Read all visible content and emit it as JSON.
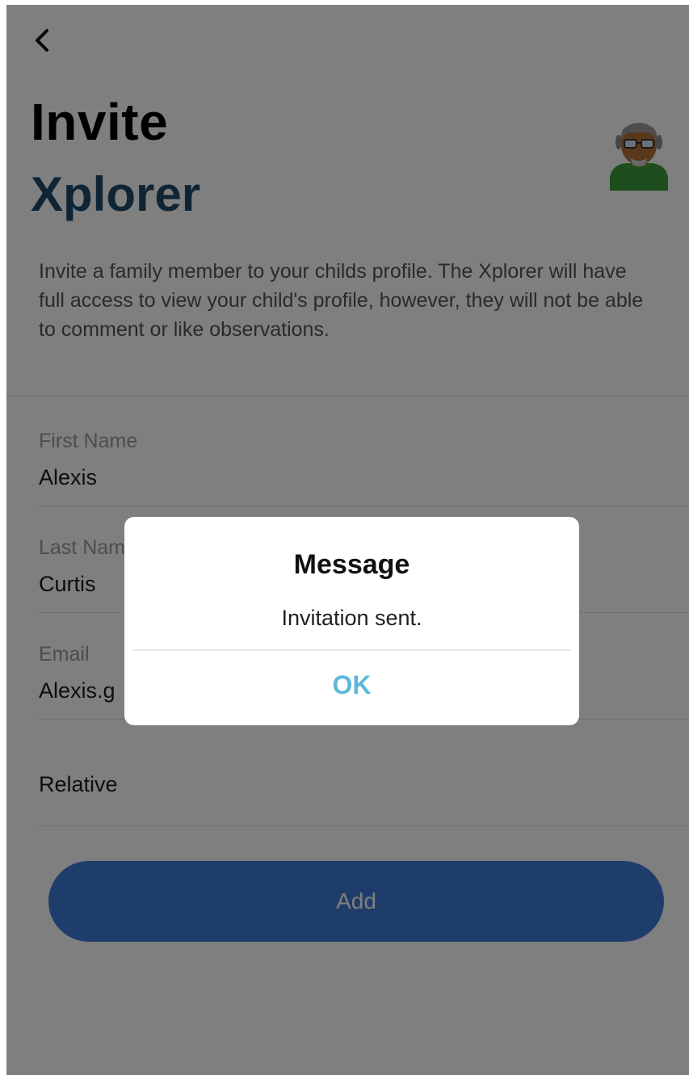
{
  "header": {
    "title": "Invite",
    "subtitle": "Xplorer",
    "avatar_icon": "elderly-man-avatar-icon"
  },
  "description": "Invite a family member to your childs profile. The Xplorer will have full access to view your child's profile, however, they will not be able to comment or like observations.",
  "form": {
    "first_name": {
      "label": "First Name",
      "value": "Alexis"
    },
    "last_name": {
      "label": "Last Name",
      "value": "Curtis"
    },
    "email": {
      "label": "Email",
      "value": "Alexis.g"
    },
    "relationship": {
      "value": "Relative"
    },
    "submit_label": "Add"
  },
  "dialog": {
    "title": "Message",
    "message": "Invitation sent.",
    "ok_label": "OK"
  },
  "colors": {
    "accent": "#3f7bd6",
    "subtitle": "#1f4a6b",
    "ok": "#5bb8d9"
  }
}
